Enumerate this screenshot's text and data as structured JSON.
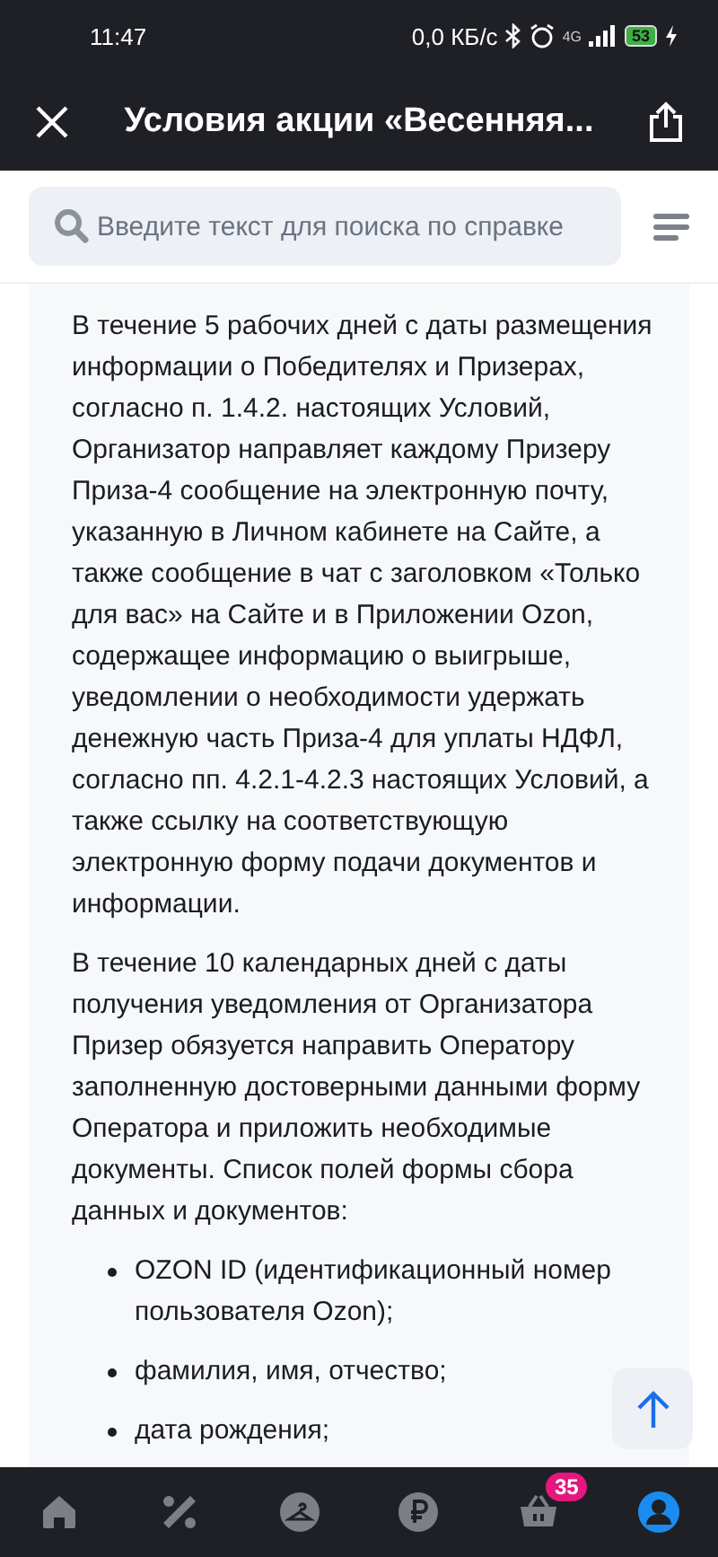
{
  "status_bar": {
    "time": "11:47",
    "speed": "0,0 КБ/с",
    "network": "4G",
    "battery": "53"
  },
  "header": {
    "title": "Условия акции «Весенняя..."
  },
  "search": {
    "placeholder": "Введите текст для поиска по справке"
  },
  "content": [
    {
      "kind": "paragraph",
      "text": "В течение 5 рабочих дней с даты размещения информации о Победителях и Призерах, согласно п. 1.4.2. настоящих Условий, Организатор направляет каждому Призеру Приза-4 сообщение на электронную почту, указанную в Личном кабинете на Сайте, а также сообщение в чат с заголовком «Только для вас» на Сайте и в Приложении Ozon, содержащее информацию о выигрыше, уведомлении о необходимости удержать денежную часть Приза-4 для уплаты НДФЛ, согласно пп. 4.2.1-4.2.3 настоящих Условий, а также ссылку на соответствующую электронную форму подачи документов и информации."
    },
    {
      "kind": "paragraph",
      "text": "В течение 10 календарных дней с даты получения уведомления от Организатора Призер обязуется направить Оператору заполненную достоверными данными форму Оператора и приложить необходимые документы. Список полей формы сбора данных и документов:"
    },
    {
      "kind": "bullet",
      "text": "OZON ID (идентификационный номер пользователя Ozon);"
    },
    {
      "kind": "bullet",
      "text": "фамилия, имя, отчество;"
    },
    {
      "kind": "bullet",
      "text": "дата рождения;"
    }
  ],
  "nav": [
    {
      "kind": "home",
      "selected": false
    },
    {
      "kind": "percent",
      "selected": false
    },
    {
      "kind": "hanger",
      "selected": false
    },
    {
      "kind": "ruble",
      "selected": false
    },
    {
      "kind": "basket",
      "selected": false,
      "badge": "35"
    },
    {
      "kind": "profile",
      "selected": true
    }
  ]
}
